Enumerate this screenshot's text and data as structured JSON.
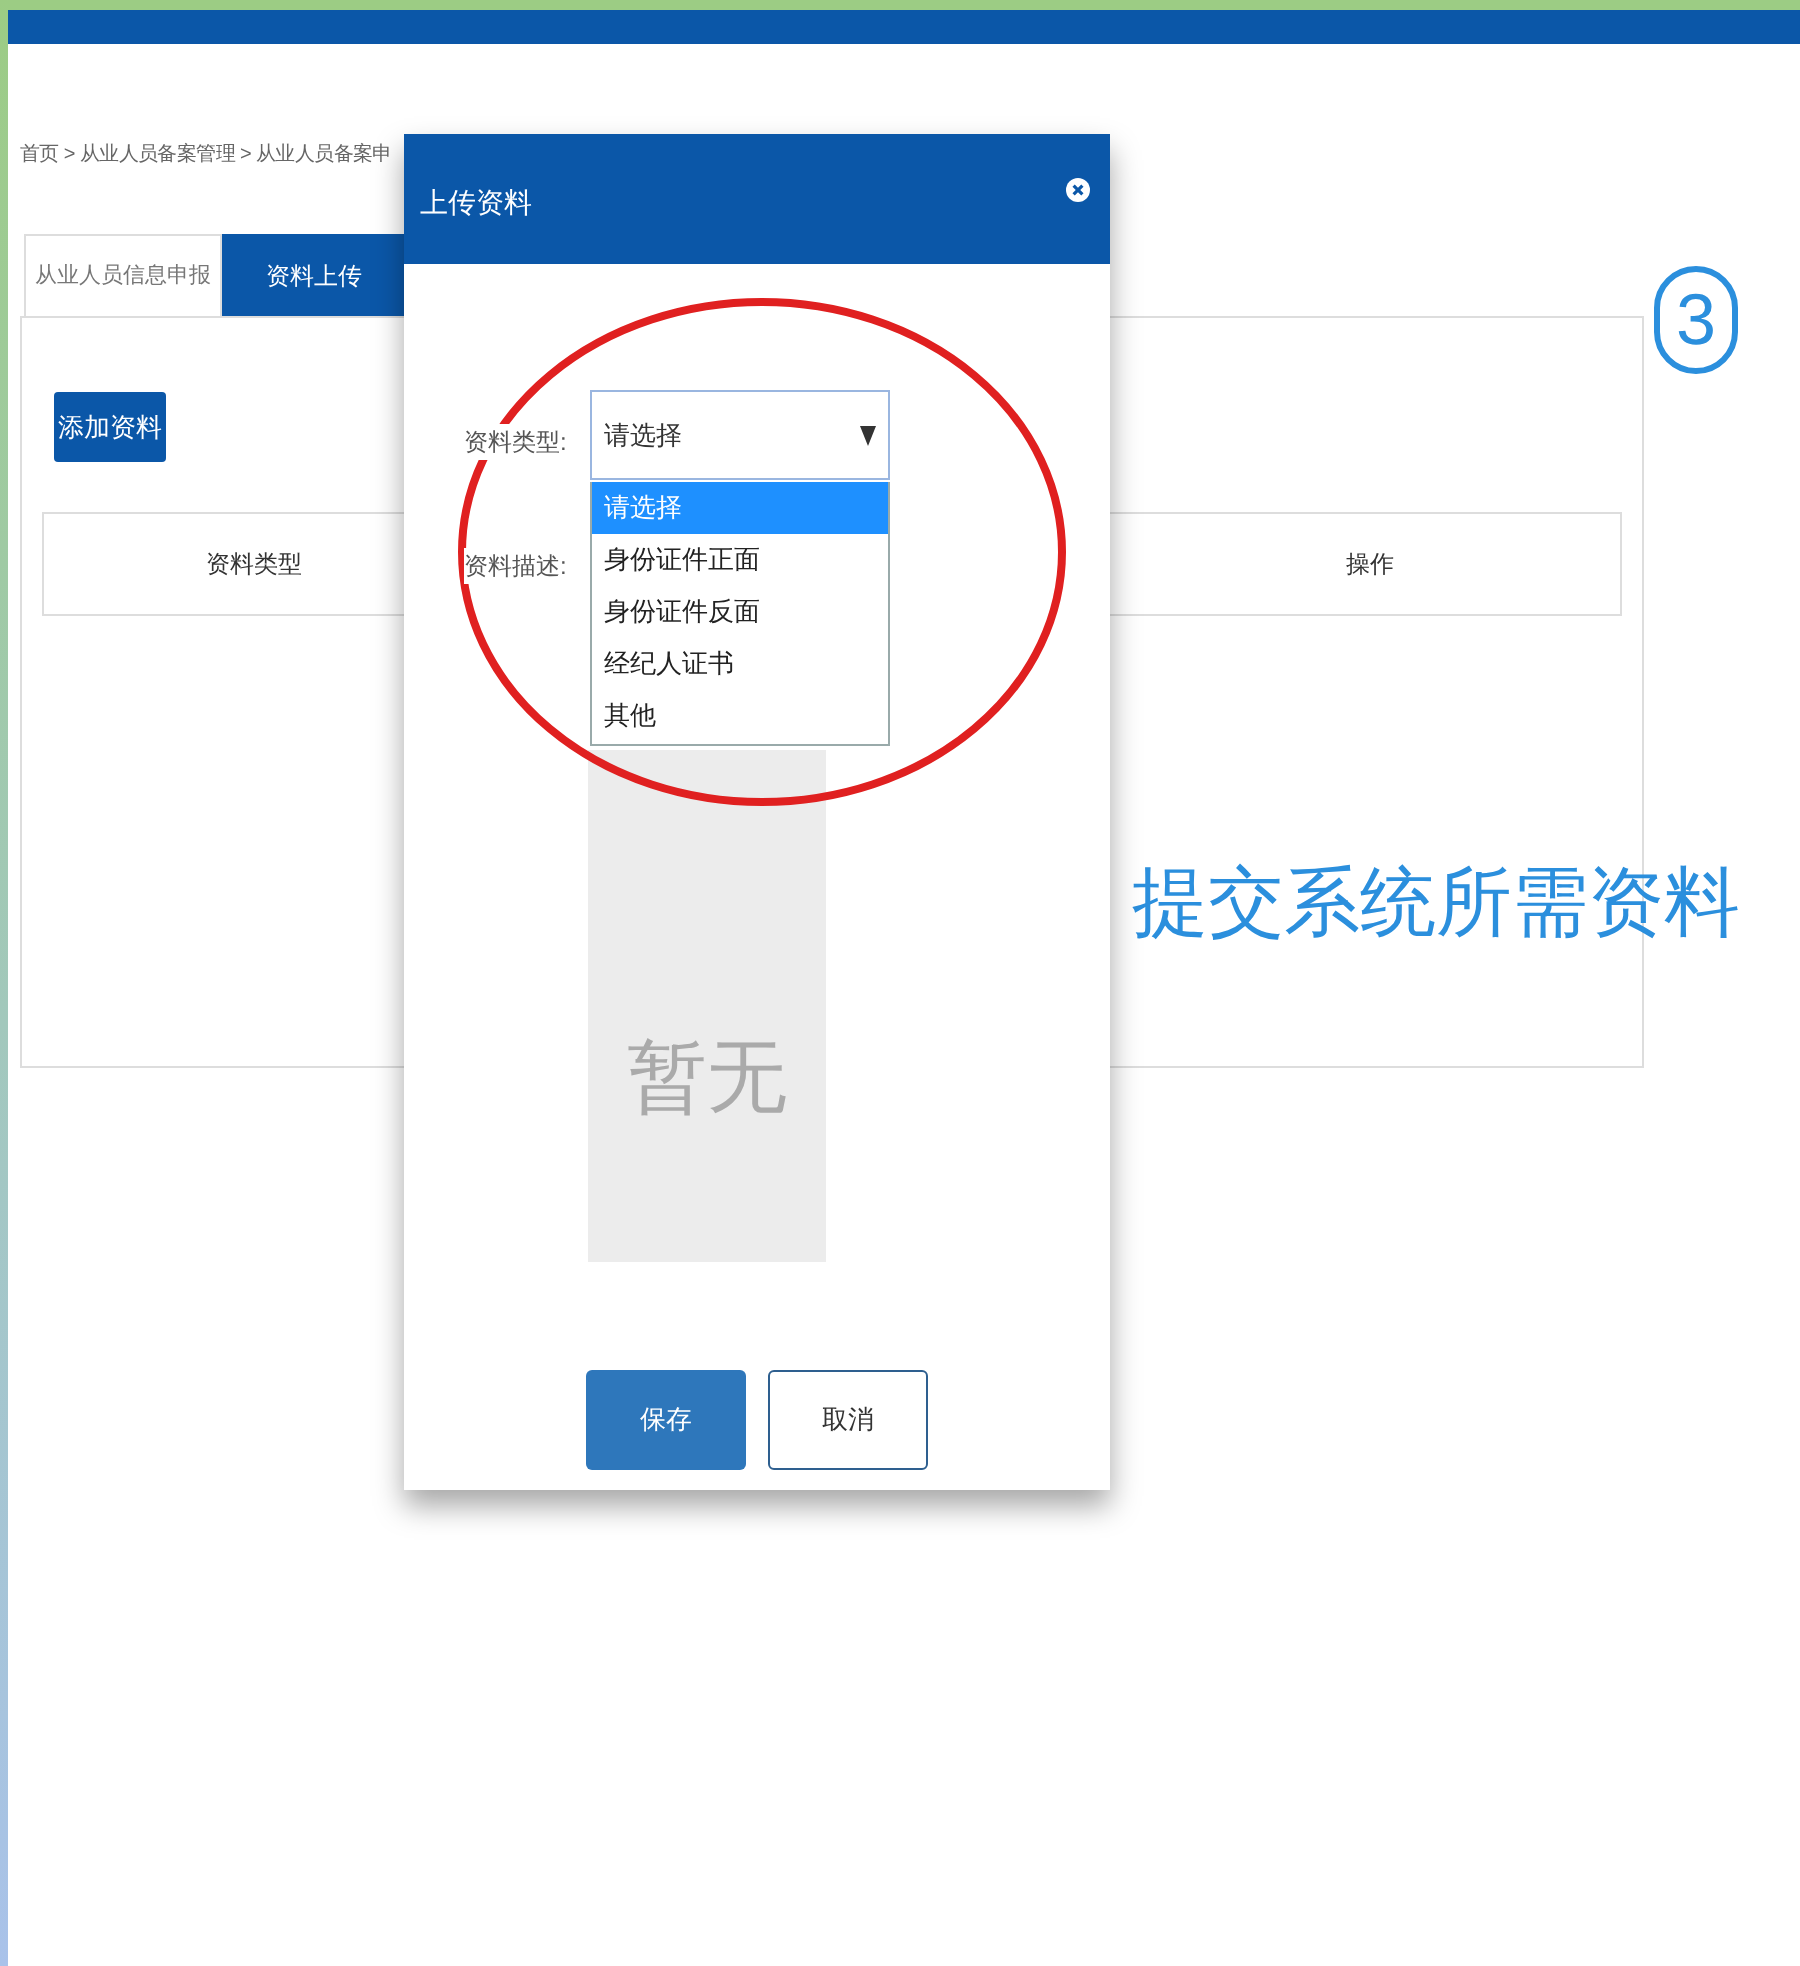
{
  "breadcrumb": "首页 > 从业人员备案管理 > 从业人员备案申",
  "tabs": [
    {
      "label": "从业人员信息申报",
      "selected": false
    },
    {
      "label": "资料上传",
      "selected": true
    }
  ],
  "add_button": "添加资料",
  "table": {
    "columns": [
      "资料类型",
      "操作"
    ]
  },
  "dialog": {
    "title": "上传资料",
    "type_label": "资料类型:",
    "type_select": {
      "value": "请选择",
      "options": [
        {
          "label": "请选择",
          "selected": true
        },
        {
          "label": "身份证件正面",
          "selected": false
        },
        {
          "label": "身份证件反面",
          "selected": false
        },
        {
          "label": "经纪人证书",
          "selected": false
        },
        {
          "label": "其他",
          "selected": false
        }
      ]
    },
    "description_label": "资料描述:",
    "image_placeholder": "暂无",
    "buttons": [
      {
        "label": "保存",
        "kind": "primary"
      },
      {
        "label": "取消",
        "kind": "secondary"
      }
    ]
  },
  "annotations": {
    "step": "3",
    "caption": "提交系统所需资料"
  }
}
